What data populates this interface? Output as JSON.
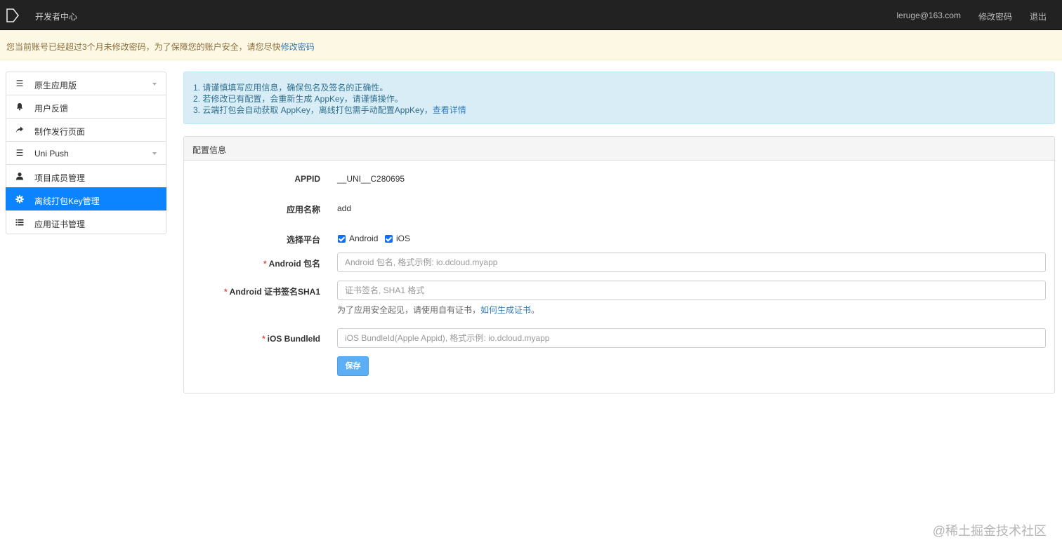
{
  "header": {
    "brand": "开发者中心",
    "email": "leruge@163.com",
    "change_password": "修改密码",
    "logout": "退出"
  },
  "warning": {
    "text": "您当前账号已经超过3个月未修改密码，为了保障您的账户安全，请您尽快",
    "link": "修改密码"
  },
  "sidebar": {
    "items": [
      {
        "label": "原生应用版",
        "icon": "list-icon",
        "dropdown": true
      },
      {
        "label": "用户反馈",
        "icon": "bell-icon"
      },
      {
        "label": "制作发行页面",
        "icon": "share-icon"
      },
      {
        "label": "Uni Push",
        "icon": "list-icon",
        "dropdown": true
      },
      {
        "label": "项目成员管理",
        "icon": "user-icon"
      },
      {
        "label": "离线打包Key管理",
        "icon": "gear-icon",
        "active": true
      },
      {
        "label": "应用证书管理",
        "icon": "list-alt-icon"
      }
    ]
  },
  "notice": {
    "line1": "1. 请谨慎填写应用信息，确保包名及签名的正确性。",
    "line2": "2. 若修改已有配置，会重新生成 AppKey，请谨慎操作。",
    "line3": "3. 云端打包会自动获取 AppKey，离线打包需手动配置AppKey，",
    "line3_link": "查看详情"
  },
  "panel": {
    "title": "配置信息",
    "appid_label": "APPID",
    "appid_value": "__UNI__C280695",
    "appname_label": "应用名称",
    "appname_value": "add",
    "platform_label": "选择平台",
    "platform_android": "Android",
    "platform_ios": "iOS",
    "android_pkg_label": "Android 包名",
    "android_pkg_placeholder": "Android 包名, 格式示例: io.dcloud.myapp",
    "android_sha1_label": "Android 证书签名SHA1",
    "android_sha1_placeholder": "证书签名, SHA1 格式",
    "cert_hint": "为了应用安全起见，请使用自有证书，",
    "cert_hint_link": "如何生成证书",
    "cert_hint_end": "。",
    "ios_label": "iOS BundleId",
    "ios_placeholder": "iOS BundleId(Apple Appid), 格式示例: io.dcloud.myapp",
    "required_mark": "*",
    "save": "保存"
  },
  "watermark": "@稀土掘金技术社区",
  "colors": {
    "topbar": "#222222",
    "active": "#0d84ff",
    "save": "#5daff5",
    "warn_bg": "#fcf8e3",
    "info_bg": "#d9edf7"
  }
}
